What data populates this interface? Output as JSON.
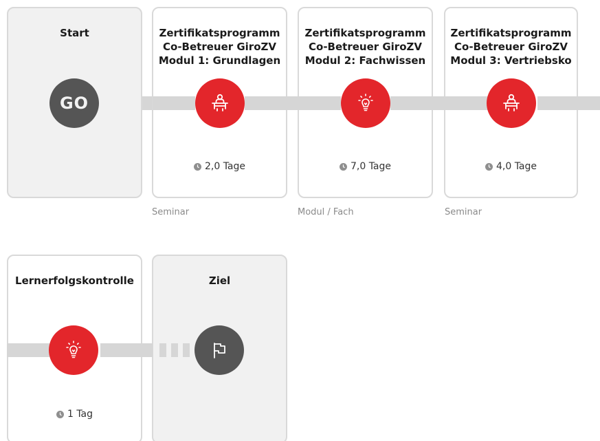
{
  "steps": [
    {
      "title_lines": [
        "Start"
      ],
      "icon": "go-icon",
      "icon_text": "GO"
    },
    {
      "title_lines": [
        "Zertifikatsprogramm",
        "Co-Betreuer GiroZV",
        "Modul 1: Grundlagen"
      ],
      "icon": "seminar-icon",
      "duration": "2,0 Tage",
      "type": "Seminar"
    },
    {
      "title_lines": [
        "Zertifikatsprogramm",
        "Co-Betreuer GiroZV",
        "Modul 2: Fachwissen"
      ],
      "icon": "lightbulb-icon",
      "duration": "7,0 Tage",
      "type": "Modul / Fach"
    },
    {
      "title_lines": [
        "Zertifikatsprogramm",
        "Co-Betreuer GiroZV",
        "Modul 3: Vertriebsko"
      ],
      "icon": "seminar-icon",
      "duration": "4,0 Tage",
      "type": "Seminar"
    },
    {
      "title_lines": [
        "Lernerfolgskontrolle"
      ],
      "icon": "lightbulb-icon",
      "duration": "1 Tag"
    },
    {
      "title_lines": [
        "Ziel"
      ],
      "icon": "flag-icon"
    }
  ],
  "colors": {
    "accent": "#e3262b",
    "dark": "#555555",
    "connector": "#d6d6d6",
    "card_border": "#d9d9d9",
    "card_grey": "#f1f1f1"
  },
  "icons": {
    "clock": "clock-icon"
  }
}
